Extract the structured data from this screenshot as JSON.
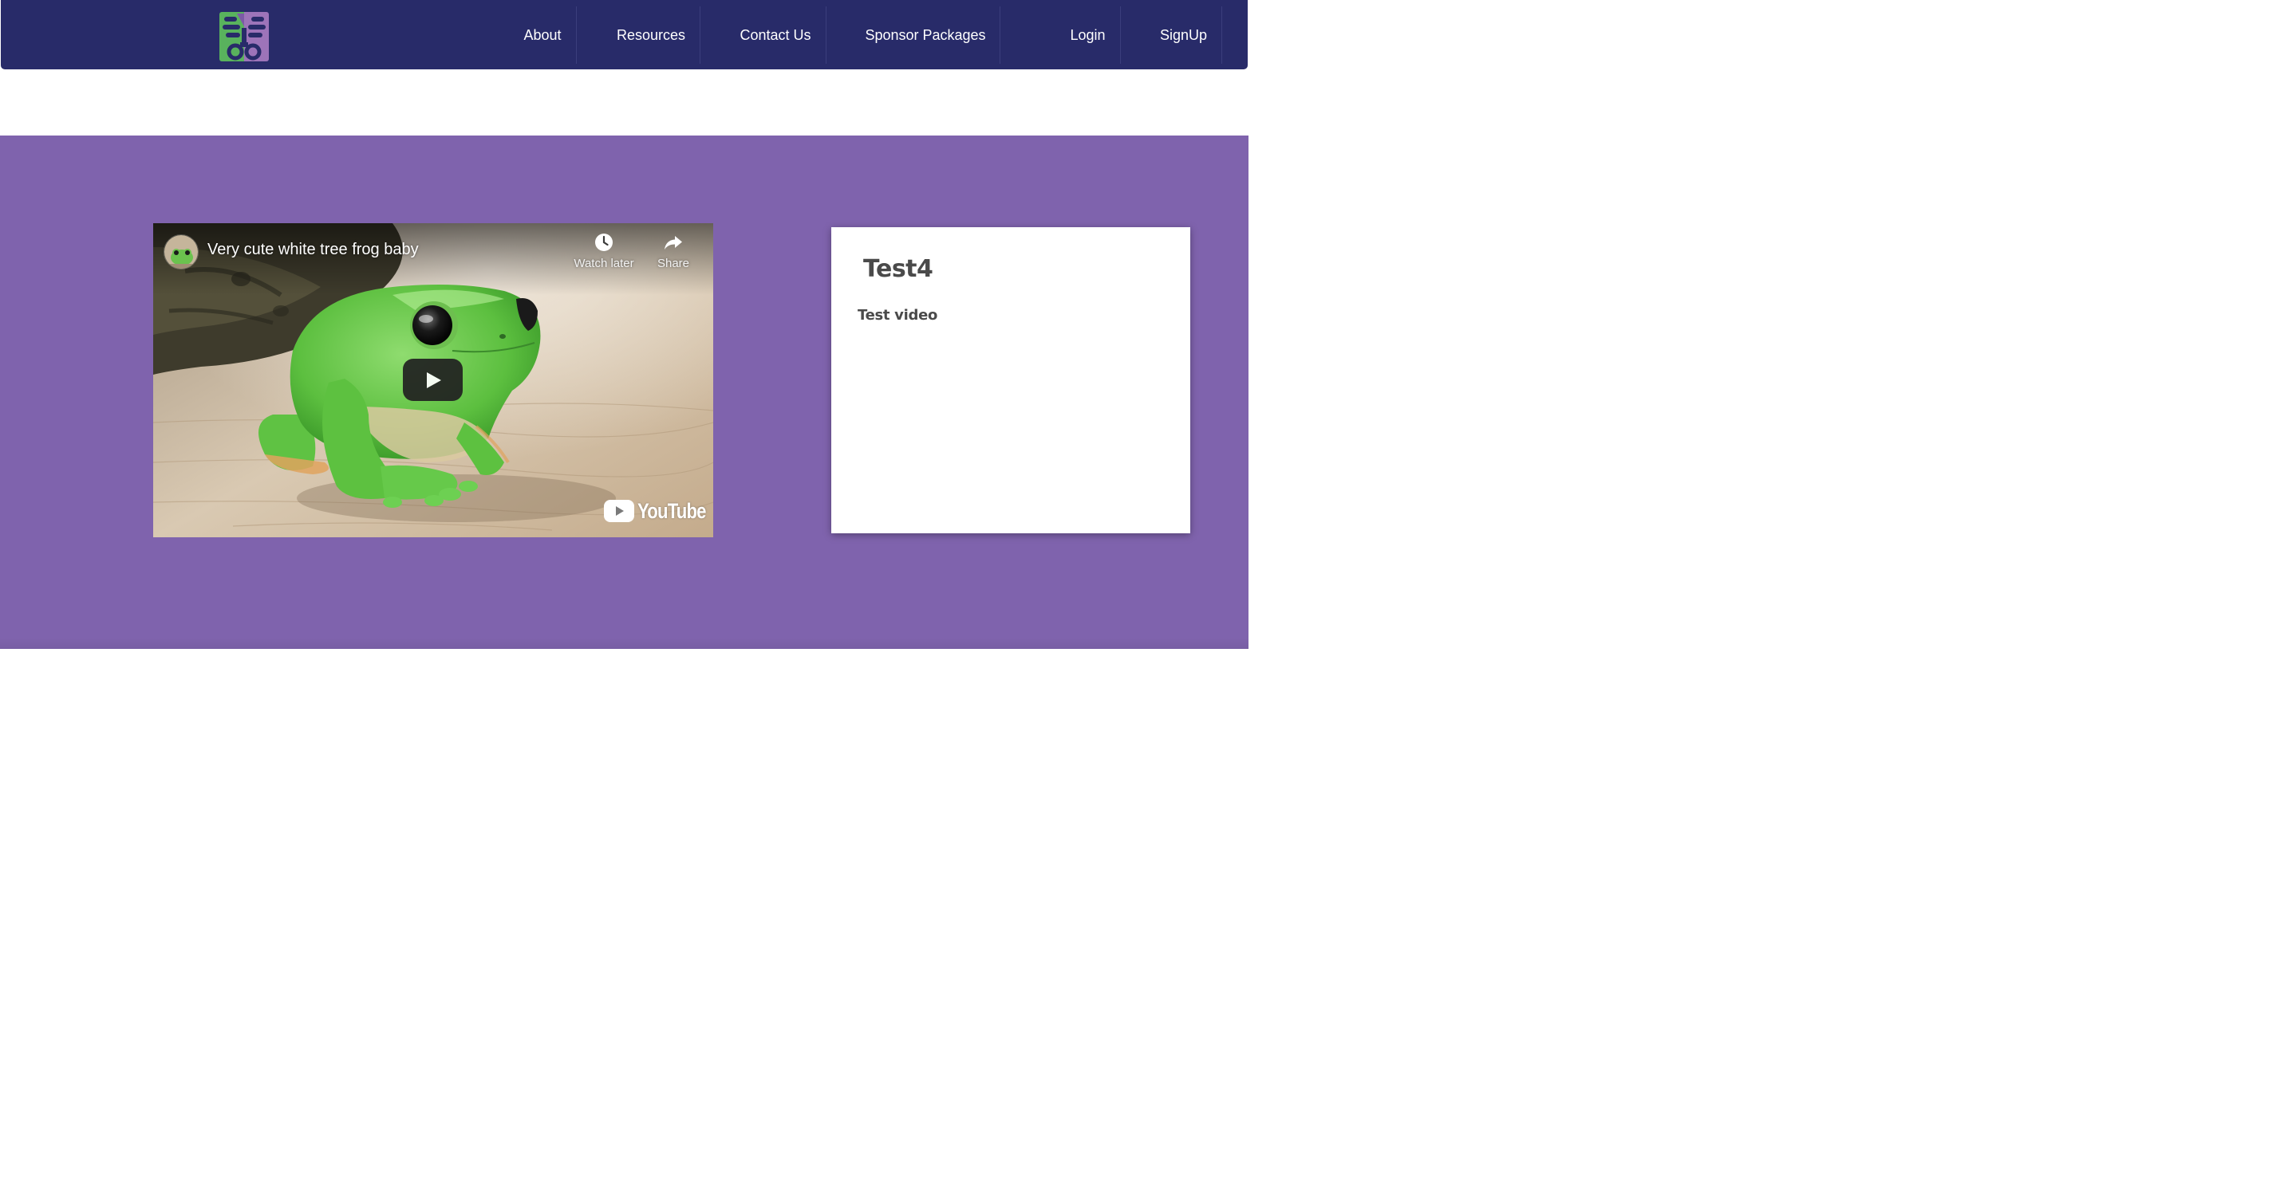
{
  "navbar": {
    "logo_icon": "site-logo",
    "items": [
      {
        "label": "About"
      },
      {
        "label": "Resources"
      },
      {
        "label": "Contact Us"
      },
      {
        "label": "Sponsor Packages"
      },
      {
        "label": "Login"
      },
      {
        "label": "SignUp"
      }
    ]
  },
  "video": {
    "title": "Very cute white tree frog baby",
    "watch_later_label": "Watch later",
    "share_label": "Share",
    "brand": "YouTube",
    "icons": [
      "clock-icon",
      "share-icon",
      "play-icon",
      "youtube-logo"
    ]
  },
  "card": {
    "title": "Test4",
    "text": "Test video"
  },
  "colors": {
    "navbar_bg": "#282b69",
    "hero_bg": "#7f63ad",
    "logo_green": "#59b25d",
    "logo_purple": "#9d74b9",
    "card_text": "#4a4a4a"
  }
}
